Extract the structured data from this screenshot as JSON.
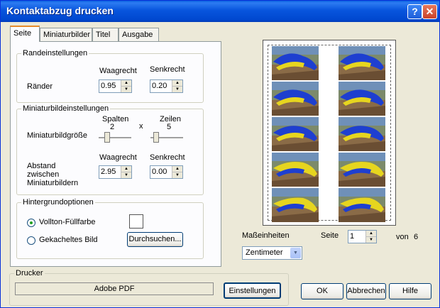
{
  "window": {
    "title": "Kontaktabzug drucken",
    "help_label": "?",
    "close_label": "✕"
  },
  "tabs": [
    "Seite",
    "Miniaturbilder",
    "Titel",
    "Ausgabe"
  ],
  "margins": {
    "legend": "Randeinstellungen",
    "row_label": "Ränder",
    "col_h": "Waagrecht",
    "col_v": "Senkrecht",
    "h_value": "0.95",
    "v_value": "0.20"
  },
  "thumbs": {
    "legend": "Miniaturbildeinstellungen",
    "size_label": "Miniaturbildgröße",
    "cols_label": "Spalten",
    "cols_value": "2",
    "times": "x",
    "rows_label": "Zeilen",
    "rows_value": "5",
    "spacing_label_1": "Abstand",
    "spacing_label_2": "zwischen",
    "spacing_label_3": "Miniaturbildern",
    "col_h": "Waagrecht",
    "col_v": "Senkrecht",
    "h_value": "2.95",
    "v_value": "0.00"
  },
  "background": {
    "legend": "Hintergrundoptionen",
    "fill_label": "Vollton-Füllfarbe",
    "tile_label": "Gekacheltes Bild",
    "browse_label": "Durchsuchen..."
  },
  "printer": {
    "legend": "Drucker",
    "name": "Adobe PDF",
    "settings_label": "Einstellungen"
  },
  "units": {
    "label": "Maßeinheiten",
    "selected": "Zentimeter"
  },
  "page": {
    "label": "Seite",
    "value": "1",
    "of_label": "von",
    "total": "6"
  },
  "buttons": {
    "ok": "OK",
    "cancel": "Abbrechen",
    "help": "Hilfe"
  },
  "icons": {
    "help": "help-icon",
    "close": "close-icon",
    "spin_up": "▲",
    "spin_down": "▼",
    "dropdown": "▼"
  }
}
